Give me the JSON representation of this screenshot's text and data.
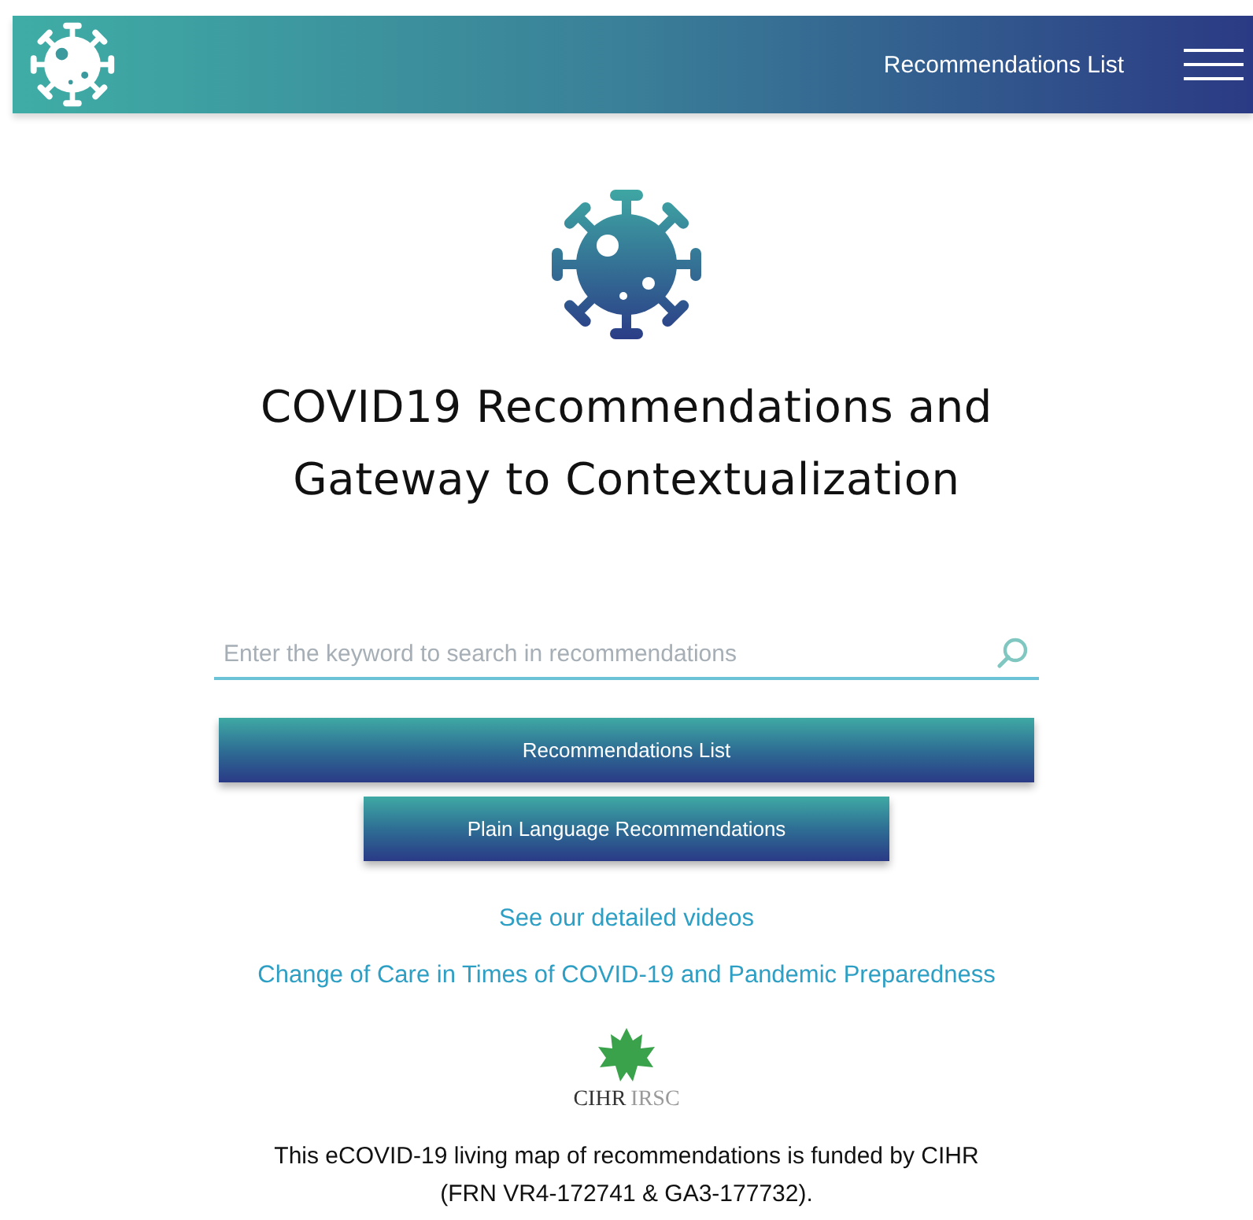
{
  "header": {
    "nav_link": "Recommendations List"
  },
  "title_lines": [
    "COVID19 Recommendations and",
    "Gateway to Contextualization"
  ],
  "search": {
    "placeholder": "Enter the keyword to search in recommendations"
  },
  "buttons": [
    {
      "label": "Recommendations List",
      "kind": "wide"
    },
    {
      "label": "Plain Language Recommendations",
      "kind": "narrow"
    }
  ],
  "links": [
    "See our detailed videos",
    "Change of Care in Times of COVID-19 and Pandemic Preparedness"
  ],
  "logo": {
    "primary": "CIHR",
    "secondary": "IRSC"
  },
  "funding": [
    "This eCOVID-19 living map of recommendations is funded by CIHR",
    "(FRN VR4-172741 & GA3-177732)."
  ]
}
